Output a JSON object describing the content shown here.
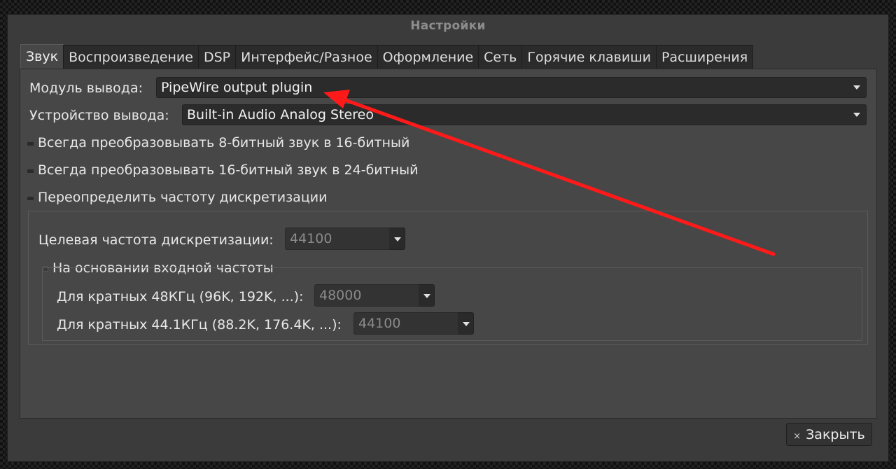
{
  "window": {
    "title": "Настройки"
  },
  "tabs": [
    {
      "label": "Звук",
      "active": true
    },
    {
      "label": "Воспроизведение",
      "active": false
    },
    {
      "label": "DSP",
      "active": false
    },
    {
      "label": "Интерфейс/Разное",
      "active": false
    },
    {
      "label": "Оформление",
      "active": false
    },
    {
      "label": "Сеть",
      "active": false
    },
    {
      "label": "Горячие клавиши",
      "active": false
    },
    {
      "label": "Расширения",
      "active": false
    }
  ],
  "sound": {
    "output_module_label": "Модуль вывода:",
    "output_module_value": "PipeWire output plugin",
    "output_device_label": "Устройство вывода:",
    "output_device_value": "Built-in Audio Analog Stereo",
    "convert8_label": "Всегда преобразовывать 8-битный звук в 16-битный",
    "convert16_label": "Всегда преобразовывать 16-битный звук в 24-битный",
    "override_rate_label": "Переопределить частоту дискретизации",
    "target_rate_label": "Целевая частота дискретизации:",
    "target_rate_value": "44100",
    "based_on_input_label": "На основании входной частоты",
    "mult48_label": "Для кратных 48КГц (96K, 192K, ...):",
    "mult48_value": "48000",
    "mult441_label": "Для кратных 44.1КГц (88.2K, 176.4K, ...):",
    "mult441_value": "44100"
  },
  "footer": {
    "close_label": "Закрыть",
    "close_icon": "×"
  },
  "colors": {
    "annotation_arrow": "#ff1a1a"
  }
}
